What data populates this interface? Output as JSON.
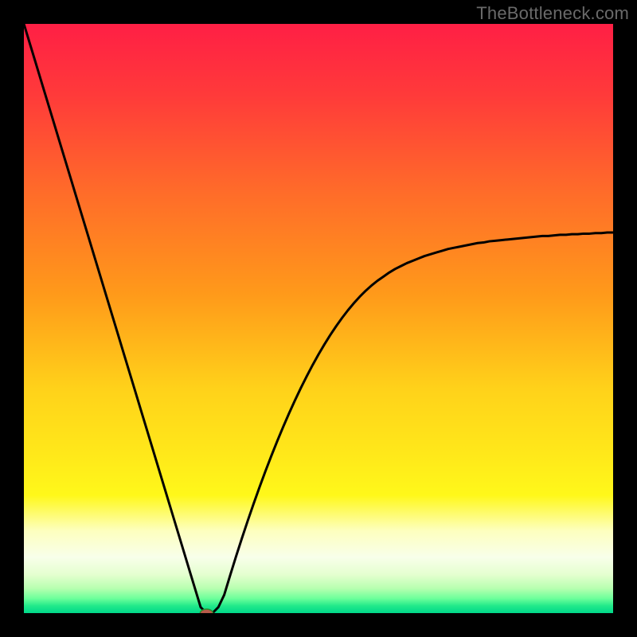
{
  "watermark": {
    "text": "TheBottleneck.com"
  },
  "colors": {
    "bg": "#000000",
    "curve": "#000000",
    "marker_fill": "#b85a4a",
    "marker_stroke": "#2a8a2a",
    "gradient_stops": [
      {
        "offset": 0.0,
        "color": "#ff1f45"
      },
      {
        "offset": 0.12,
        "color": "#ff3a3a"
      },
      {
        "offset": 0.28,
        "color": "#ff6a2a"
      },
      {
        "offset": 0.46,
        "color": "#ff9a1a"
      },
      {
        "offset": 0.62,
        "color": "#ffd21a"
      },
      {
        "offset": 0.73,
        "color": "#ffe81a"
      },
      {
        "offset": 0.8,
        "color": "#fff81a"
      },
      {
        "offset": 0.86,
        "color": "#fdffbe"
      },
      {
        "offset": 0.905,
        "color": "#f8ffea"
      },
      {
        "offset": 0.935,
        "color": "#e4ffcf"
      },
      {
        "offset": 0.958,
        "color": "#b7ffb0"
      },
      {
        "offset": 0.975,
        "color": "#6dff9b"
      },
      {
        "offset": 0.988,
        "color": "#20e98a"
      },
      {
        "offset": 1.0,
        "color": "#00d88a"
      }
    ]
  },
  "chart_data": {
    "type": "line",
    "title": "",
    "xlabel": "",
    "ylabel": "",
    "categories": [
      0,
      1,
      2,
      3,
      4,
      5,
      6,
      7,
      8,
      9,
      10,
      11,
      12,
      13,
      14,
      15,
      16,
      17,
      18,
      19,
      20,
      21,
      22,
      23,
      24,
      25,
      26,
      27,
      28,
      29,
      30,
      31,
      32,
      33,
      34,
      35,
      36,
      37,
      38,
      39,
      40,
      41,
      42,
      43,
      44,
      45,
      46,
      47,
      48,
      49,
      50,
      51,
      52,
      53,
      54,
      55,
      56,
      57,
      58,
      59,
      60,
      61,
      62,
      63,
      64,
      65,
      66,
      67,
      68,
      69,
      70,
      71,
      72,
      73,
      74,
      75,
      76,
      77,
      78,
      79,
      80,
      81,
      82,
      83,
      84,
      85,
      86,
      87,
      88,
      89,
      90,
      91,
      92,
      93,
      94,
      95,
      96,
      97,
      98,
      99,
      100
    ],
    "series": [
      {
        "name": "bottleneck-curve",
        "values": [
          100,
          96.7,
          93.4,
          90.1,
          86.8,
          83.5,
          80.2,
          76.9,
          73.6,
          70.3,
          67,
          63.7,
          60.4,
          57.1,
          53.8,
          50.5,
          47.2,
          43.9,
          40.6,
          37.3,
          34,
          30.7,
          27.4,
          24.1,
          20.8,
          17.5,
          14.2,
          10.9,
          7.6,
          4.3,
          1,
          0,
          0,
          1,
          3.1,
          6.4,
          9.6,
          12.7,
          15.7,
          18.6,
          21.4,
          24.1,
          26.7,
          29.2,
          31.6,
          33.9,
          36.1,
          38.2,
          40.2,
          42.1,
          43.9,
          45.6,
          47.2,
          48.7,
          50.1,
          51.4,
          52.6,
          53.7,
          54.7,
          55.6,
          56.4,
          57.1,
          57.8,
          58.4,
          58.9,
          59.4,
          59.8,
          60.2,
          60.6,
          60.9,
          61.2,
          61.5,
          61.8,
          62,
          62.2,
          62.4,
          62.6,
          62.8,
          62.9,
          63.1,
          63.2,
          63.3,
          63.4,
          63.5,
          63.6,
          63.7,
          63.8,
          63.9,
          64,
          64,
          64.1,
          64.2,
          64.2,
          64.3,
          64.3,
          64.4,
          64.4,
          64.5,
          64.5,
          64.6,
          64.6
        ]
      }
    ],
    "xlim": [
      0,
      100
    ],
    "ylim": [
      0,
      100
    ],
    "marker": {
      "x": 31,
      "y": 0,
      "rx": 8,
      "ry": 5
    }
  }
}
